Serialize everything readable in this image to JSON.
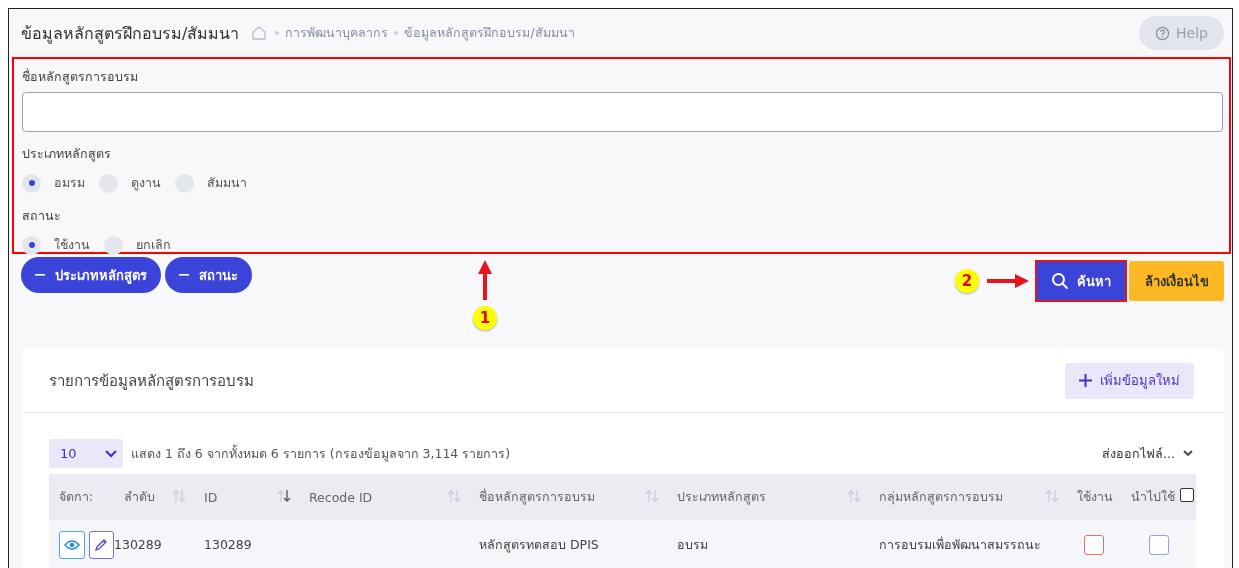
{
  "page": {
    "title": "ข้อมูลหลักสูตรฝึกอบรม/สัมมนา",
    "breadcrumbs": [
      "การพัฒนาบุคลากร",
      "ข้อมูลหลักสูตรฝึกอบรม/สัมมนา"
    ],
    "help_button": "Help"
  },
  "filter": {
    "name_label": "ชื่อหลักสูตรการอบรม",
    "type_label": "ประเภทหลักสูตร",
    "type_options": [
      {
        "label": "อมรม",
        "selected": true
      },
      {
        "label": "ดูงาน",
        "selected": false
      },
      {
        "label": "สัมมนา",
        "selected": false
      }
    ],
    "status_label": "สถานะ",
    "status_options": [
      {
        "label": "ใช้งาน",
        "selected": true
      },
      {
        "label": "ยกเลิก",
        "selected": false
      }
    ],
    "chips": [
      "ประเภทหลักสูตร",
      "สถานะ"
    ],
    "search_button": "ค้นหา",
    "clear_button": "ล้างเงื่อนไข"
  },
  "callouts": [
    "1",
    "2"
  ],
  "card": {
    "title": "รายการข้อมูลหลักสูตรการอบรม",
    "add_button": "เพิ่มข้อมูลใหม่",
    "page_size": "10",
    "info": "แสดง 1 ถึง 6 จากทั้งหมด 6 รายการ (กรองข้อมูลจาก 3,114 รายการ)",
    "export": "ส่งออกไฟล์..."
  },
  "table": {
    "columns": [
      {
        "label": "จัดกา:",
        "kind": "plain"
      },
      {
        "label": "ลำดับ",
        "sorted": false,
        "kind": "sortable"
      },
      {
        "label": "ID",
        "sorted": true,
        "kind": "sortable"
      },
      {
        "label": "Recode ID",
        "sorted": false,
        "kind": "sortable"
      },
      {
        "label": "ชื่อหลักสูตรการอบรม",
        "sorted": false,
        "kind": "sortable"
      },
      {
        "label": "ประเภทหลักสูตร",
        "sorted": false,
        "kind": "sortable"
      },
      {
        "label": "กลุ่มหลักสูตรการอบรม",
        "sorted": false,
        "kind": "sortable"
      },
      {
        "label": "ใช้งาน",
        "kind": "plain"
      },
      {
        "label": "นำไปใช้",
        "kind": "checkall"
      }
    ],
    "select_all_checked": false,
    "rows": [
      {
        "order": "130289",
        "id": "130289",
        "recode_id": "",
        "name": "หลักสูตรทดสอบ DPIS",
        "type": "อบรม",
        "group": "การอบรมเพื่อพัฒนาสมรรถนะ",
        "active_checked": false,
        "use_checked": false
      }
    ]
  }
}
